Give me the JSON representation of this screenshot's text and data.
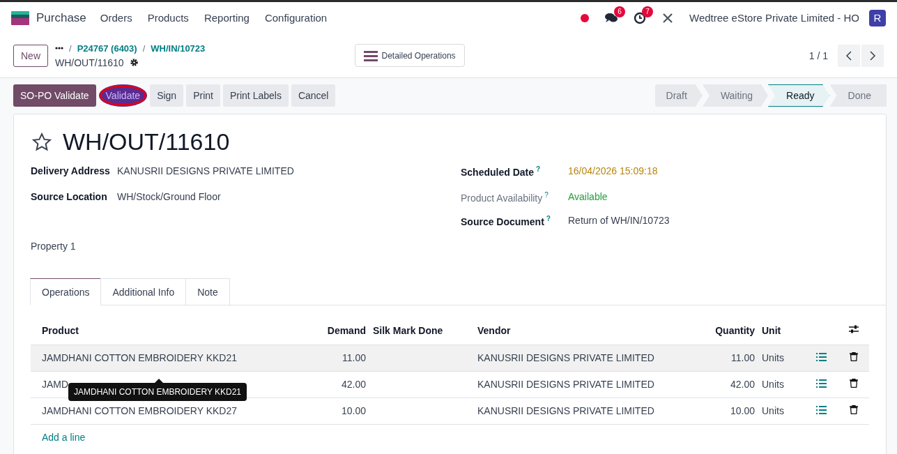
{
  "app": {
    "name": "Purchase",
    "menu": [
      "Orders",
      "Products",
      "Reporting",
      "Configuration"
    ]
  },
  "systray": {
    "messages_count": "6",
    "activities_count": "7",
    "company": "Wedtree eStore Private Limited - HO",
    "avatar": "R"
  },
  "control_panel": {
    "new_button": "New",
    "breadcrumbs": [
      {
        "separator": "/",
        "label": "P24767 (6403)"
      },
      {
        "separator": "/",
        "label": "WH/IN/10723"
      }
    ],
    "current": "WH/OUT/11610",
    "view_button": "Detailed Operations",
    "pager": "1 / 1"
  },
  "actions": [
    {
      "label": "SO-PO Validate",
      "kind": "primary",
      "circled": false
    },
    {
      "label": "Validate",
      "kind": "accent",
      "circled": true
    },
    {
      "label": "Sign",
      "kind": "secondary",
      "circled": false
    },
    {
      "label": "Print",
      "kind": "secondary",
      "circled": false
    },
    {
      "label": "Print Labels",
      "kind": "secondary",
      "circled": false
    },
    {
      "label": "Cancel",
      "kind": "secondary",
      "circled": false
    }
  ],
  "status_steps": [
    {
      "label": "Draft",
      "selected": false
    },
    {
      "label": "Waiting",
      "selected": false
    },
    {
      "label": "Ready",
      "selected": true
    },
    {
      "label": "Done",
      "selected": false
    }
  ],
  "record": {
    "title": "WH/OUT/11610",
    "starred": false,
    "left_fields": [
      {
        "label": "Delivery Address",
        "value": "KANUSRII DESIGNS PRIVATE LIMITED"
      },
      {
        "label": "Source Location",
        "value": "WH/Stock/Ground Floor"
      }
    ],
    "property": "Property 1",
    "right_fields": [
      {
        "label": "Scheduled Date",
        "help": "?",
        "value": "16/04/2026 15:09:18",
        "color": "#b8860b",
        "muted_label": false
      },
      {
        "label": "Product Availability",
        "help": "?",
        "value": "Available",
        "color": "#21a03b",
        "muted_label": true
      },
      {
        "label": "Source Document",
        "help": "?",
        "value": "Return of WH/IN/10723",
        "color": "#374151",
        "muted_label": false
      }
    ]
  },
  "tabs": [
    {
      "label": "Operations",
      "selected": true
    },
    {
      "label": "Additional Info",
      "selected": false
    },
    {
      "label": "Note",
      "selected": false
    }
  ],
  "table": {
    "columns": [
      "Product",
      "Demand",
      "Silk Mark Done",
      "Vendor",
      "Quantity",
      "Unit"
    ],
    "rows": [
      {
        "product": "JAMDHANI COTTON EMBROIDERY KKD21",
        "demand": "11.00",
        "vendor": "KANUSRII DESIGNS PRIVATE LIMITED",
        "quantity": "11.00",
        "unit": "Units",
        "hovered": true
      },
      {
        "product": "JAMD",
        "demand": "42.00",
        "vendor": "KANUSRII DESIGNS PRIVATE LIMITED",
        "quantity": "42.00",
        "unit": "Units",
        "hovered": false
      },
      {
        "product": "JAMDHANI COTTON EMBROIDERY KKD27",
        "demand": "10.00",
        "vendor": "KANUSRII DESIGNS PRIVATE LIMITED",
        "quantity": "10.00",
        "unit": "Units",
        "hovered": false
      }
    ],
    "add_line": "Add a line"
  },
  "tooltip": {
    "text": "JAMDHANI COTTON EMBROIDERY KKD21"
  }
}
